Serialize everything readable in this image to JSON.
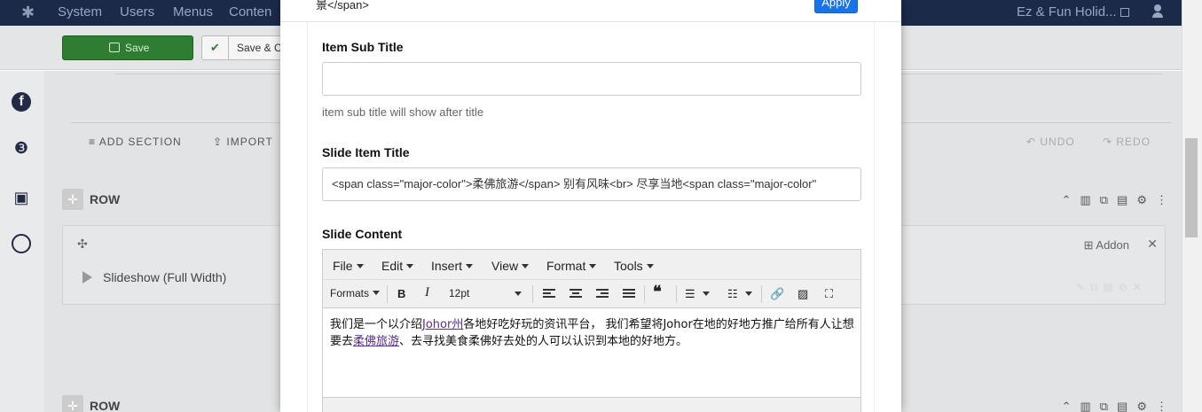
{
  "topnav": {
    "items": [
      "System",
      "Users",
      "Menus",
      "Conten"
    ],
    "site_name": "Ez & Fun Holid..."
  },
  "toolbar": {
    "save_label": "Save",
    "save_close_label": "Save & C"
  },
  "builder": {
    "add_section": "ADD SECTION",
    "import": "IMPORT",
    "undo": "UNDO",
    "redo": "REDO"
  },
  "rows": [
    {
      "label": "ROW"
    },
    {
      "label": "ROW"
    }
  ],
  "column": {
    "addon_label": "Addon",
    "addon_item": "Slideshow (Full Width)"
  },
  "modal": {
    "head_text": "景</span>",
    "apply_label": "Apply",
    "sub_title_label": "Item Sub Title",
    "sub_title_value": "",
    "sub_title_help": "item sub title will show after title",
    "slide_title_label": "Slide Item Title",
    "slide_title_value": "<span class=\"major-color\">柔佛旅游</span> 别有风味<br> 尽享当地<span class=\"major-color\"",
    "slide_content_label": "Slide Content"
  },
  "editor": {
    "menus": [
      "File",
      "Edit",
      "Insert",
      "View",
      "Format",
      "Tools"
    ],
    "formats_label": "Formats",
    "font_size": "12pt",
    "content": {
      "p1_before": "我们是一个以介绍",
      "link1": "Johor州",
      "p1_after": "各地好吃好玩的资讯平台， 我们希望将Johor在地的好地方推广给所有人让想要去",
      "link2": "柔佛旅游",
      "p1_end": "、去寻找美食柔佛好去处的人可以认识到本地的好地方。"
    }
  },
  "colors": {
    "nav_bg": "#1c2a4a",
    "save_green": "#2e7d32",
    "apply_blue": "#1a73e8",
    "link_purple": "#5a2d8a"
  }
}
